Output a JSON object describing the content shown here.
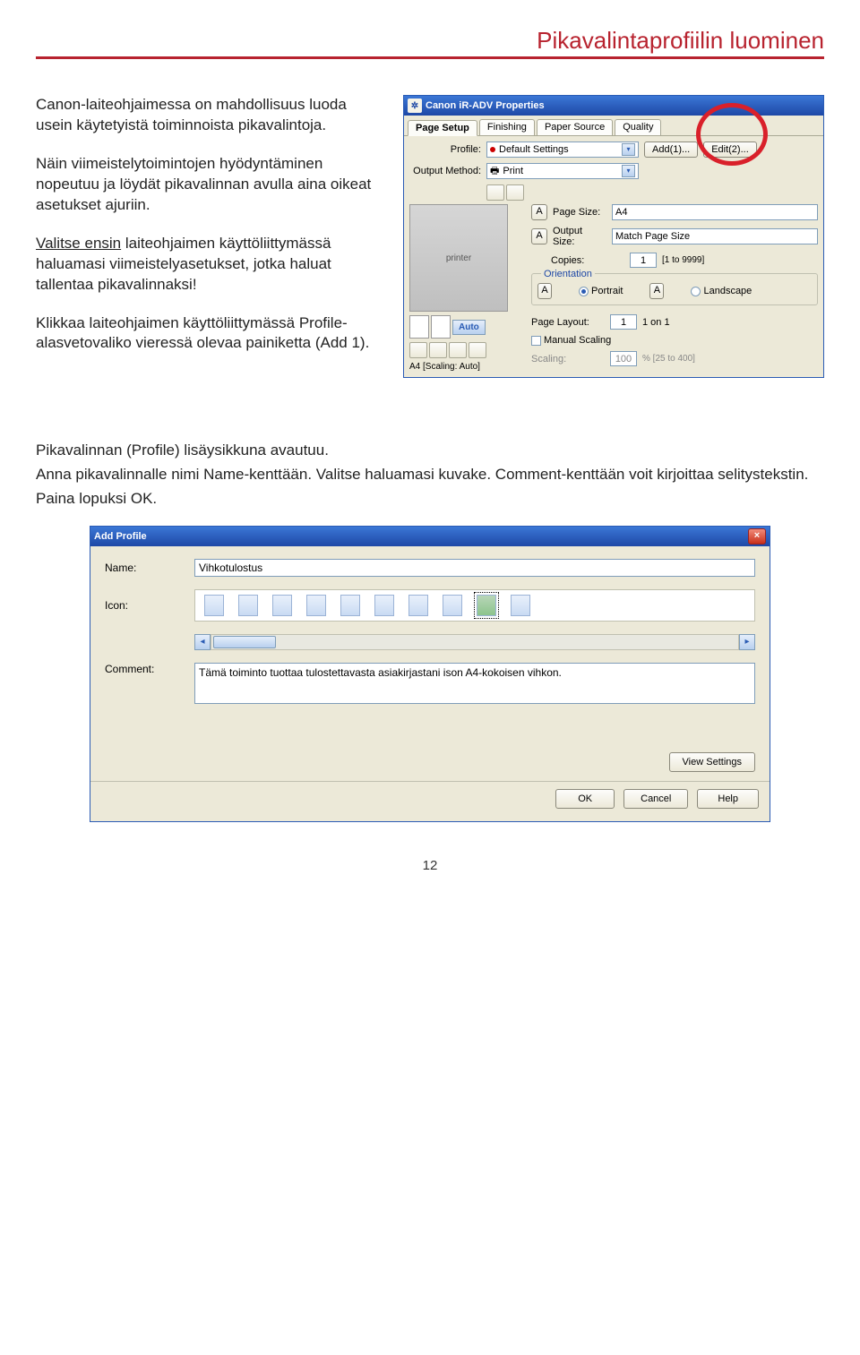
{
  "header": {
    "title": "Pikavalintaprofiilin luominen"
  },
  "intro": {
    "p1": "Canon-laiteohjaimessa on mahdollisuus luoda usein käytetyistä toiminnoista pikavalintoja.",
    "p2": "Näin viimeistelytoimintojen hyödyntäminen nopeutuu ja löydät pikavalinnan avulla aina oikeat asetukset ajuriin.",
    "p3_lead": "Valitse ensin",
    "p3_rest": " laiteohjaimen käyttöliittymässä haluamasi viimeistelyasetukset, jotka haluat tallentaa pikavalinnaksi!",
    "p4": "Klikkaa laiteohjaimen käyttöliittymässä Profile-alasvetovaliko vieressä olevaa painiketta (Add 1)."
  },
  "props": {
    "title": "Canon iR-ADV Properties",
    "tabs": {
      "t1": "Page Setup",
      "t2": "Finishing",
      "t3": "Paper Source",
      "t4": "Quality"
    },
    "profile_lbl": "Profile:",
    "profile_val": "Default Settings",
    "add_btn": "Add(1)...",
    "edit_btn": "Edit(2)...",
    "output_lbl": "Output Method:",
    "output_val": "Print",
    "page_size_lbl": "Page Size:",
    "page_size_val": "A4",
    "output_size_lbl": "Output Size:",
    "output_size_val": "Match Page Size",
    "copies_lbl": "Copies:",
    "copies_val": "1",
    "copies_range": "[1 to 9999]",
    "orient_title": "Orientation",
    "portrait": "Portrait",
    "landscape": "Landscape",
    "page_layout_lbl": "Page Layout:",
    "page_layout_val": "1 on 1",
    "manual_scaling": "Manual Scaling",
    "scaling_lbl": "Scaling:",
    "scaling_val": "100",
    "scaling_range": "% [25 to 400]",
    "preview_caption": "A4 [Scaling: Auto]",
    "auto_btn": "Auto",
    "a_badge": "A"
  },
  "mid": {
    "p1": "Pikavalinnan (Profile) lisäysikkuna avautuu.",
    "p2": "Anna pikavalinnalle nimi Name-kenttään. Valitse haluamasi kuvake. Comment-kenttään voit kirjoittaa selitystekstin.",
    "p3": "Paina lopuksi OK."
  },
  "addprof": {
    "title": "Add Profile",
    "name_lbl": "Name:",
    "name_val": "Vihkotulostus",
    "icon_lbl": "Icon:",
    "comment_lbl": "Comment:",
    "comment_val": "Tämä toiminto tuottaa tulostettavasta asiakirjastani ison A4-kokoisen vihkon.",
    "view_settings": "View Settings",
    "ok": "OK",
    "cancel": "Cancel",
    "help": "Help"
  },
  "page_number": "12"
}
